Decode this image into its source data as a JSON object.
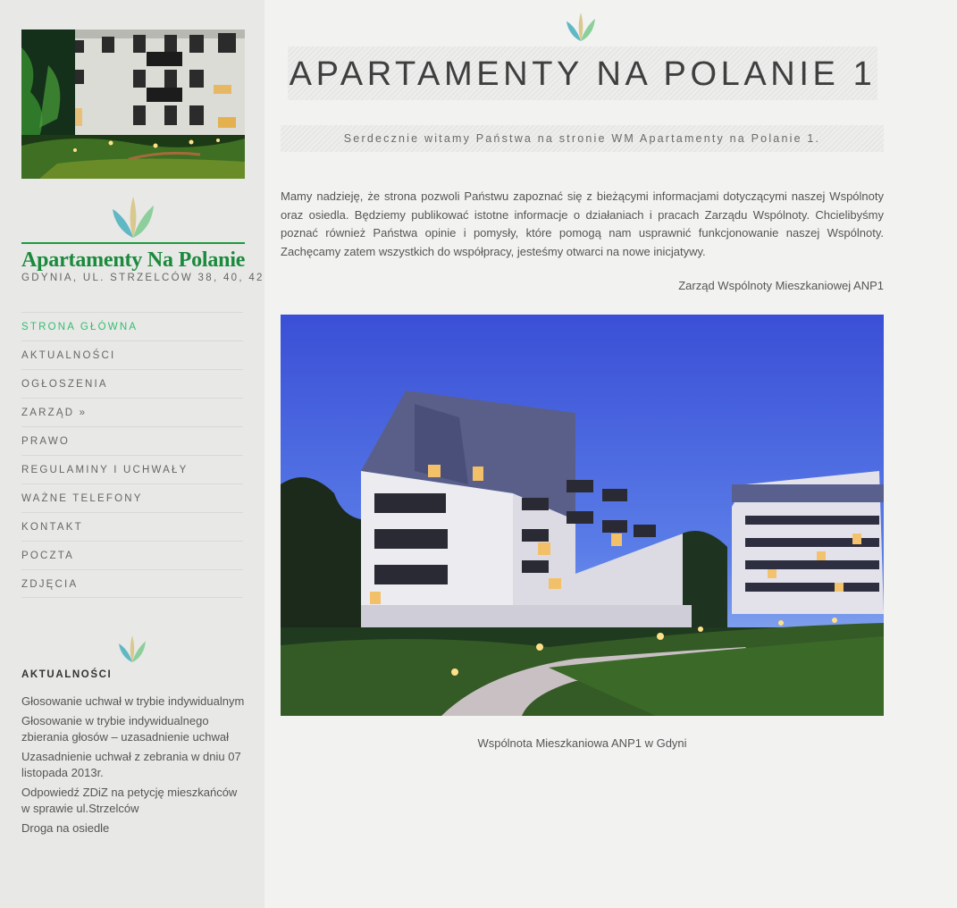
{
  "sidebar": {
    "brand": {
      "name": "Apartamenty Na Polanie",
      "address": "GDYNIA, UL. STRZELCÓW 38, 40, 42"
    },
    "nav": [
      {
        "label": "STRONA GŁÓWNA",
        "active": true
      },
      {
        "label": "AKTUALNOŚCI"
      },
      {
        "label": "OGŁOSZENIA"
      },
      {
        "label": "ZARZĄD »"
      },
      {
        "label": "PRAWO"
      },
      {
        "label": "REGULAMINY I UCHWAŁY"
      },
      {
        "label": "WAŻNE TELEFONY"
      },
      {
        "label": "KONTAKT"
      },
      {
        "label": "POCZTA"
      },
      {
        "label": "ZDJĘCIA"
      }
    ],
    "news": {
      "title": "AKTUALNOŚCI",
      "items": [
        "Głosowanie uchwał w trybie indywidualnym",
        "Głosowanie w trybie indywidualnego zbierania głosów – uzasadnienie uchwał",
        "Uzasadnienie uchwał z zebrania w dniu 07 listopada 2013r.",
        "Odpowiedź ZDiZ na petycję mieszkańców w sprawie ul.Strzelców",
        "Droga na osiedle"
      ]
    }
  },
  "main": {
    "title": "APARTAMENTY NA POLANIE 1",
    "welcome": "Serdecznie witamy Państwa na stronie WM Apartamenty na Polanie 1.",
    "intro": "Mamy nadzieję, że strona pozwoli Państwu zapoznać się z bieżącymi informacjami dotyczącymi naszej Wspólnoty oraz osiedla. Będziemy publikować istotne informacje o działaniach i pracach Zarządu Wspólnoty. Chcielibyśmy poznać również Państwa opinie i pomysły, które pomogą nam usprawnić funkcjonowanie naszej Wspólnoty. Zachęcamy zatem wszystkich do współpracy, jesteśmy otwarci na nowe inicjatywy.",
    "signature": "Zarząd Wspólnoty Mieszkaniowej ANP1",
    "caption": "Wspólnota Mieszkaniowa ANP1 w Gdyni"
  },
  "colors": {
    "accent_green": "#2fbf6f",
    "brand_green": "#1a8a3c",
    "leaf_teal": "#5fb8c4",
    "leaf_green": "#8ccf9a",
    "leaf_tan": "#d9c98f"
  }
}
